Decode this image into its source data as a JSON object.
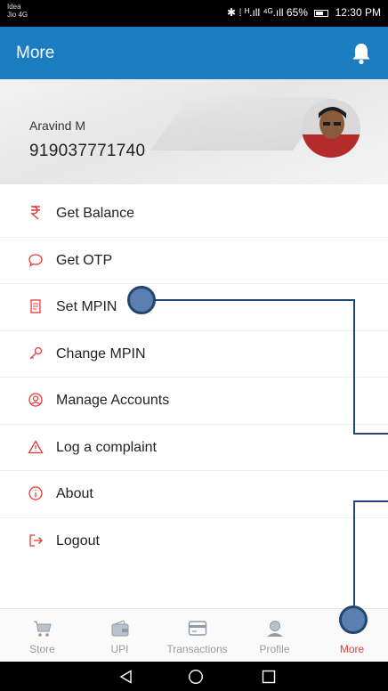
{
  "status_bar": {
    "carrier_line1": "Idea",
    "carrier_line2": "Jio 4G",
    "indicators": "✱ ⁞ ᴴ.ıll ⁴ᴳ.ıll 65%",
    "battery_icon": "battery-icon",
    "time": "12:30 PM"
  },
  "app_bar": {
    "title": "More",
    "notification_icon": "bell-icon"
  },
  "profile": {
    "name": "Aravind M",
    "phone": "919037771740"
  },
  "menu": {
    "items": [
      {
        "label": "Get Balance",
        "icon": "rupee-icon"
      },
      {
        "label": "Get OTP",
        "icon": "chat-bubble-icon"
      },
      {
        "label": "Set MPIN",
        "icon": "document-icon"
      },
      {
        "label": "Change MPIN",
        "icon": "key-icon"
      },
      {
        "label": "Manage Accounts",
        "icon": "account-circle-icon"
      },
      {
        "label": "Log a complaint",
        "icon": "warning-icon"
      },
      {
        "label": "About",
        "icon": "info-icon"
      },
      {
        "label": "Logout",
        "icon": "logout-icon"
      }
    ]
  },
  "bottom_nav": {
    "items": [
      {
        "label": "Store",
        "icon": "cart-icon"
      },
      {
        "label": "UPI",
        "icon": "wallet-icon"
      },
      {
        "label": "Transactions",
        "icon": "card-icon"
      },
      {
        "label": "Profile",
        "icon": "person-icon"
      },
      {
        "label": "More",
        "icon": "more-dots-icon",
        "active": true
      }
    ]
  },
  "colors": {
    "app_bar": "#1a7cc1",
    "menu_icon": "#e53935",
    "active_nav": "#e53935",
    "inactive_nav": "#9b9b9b",
    "annotation": "#21476f"
  }
}
